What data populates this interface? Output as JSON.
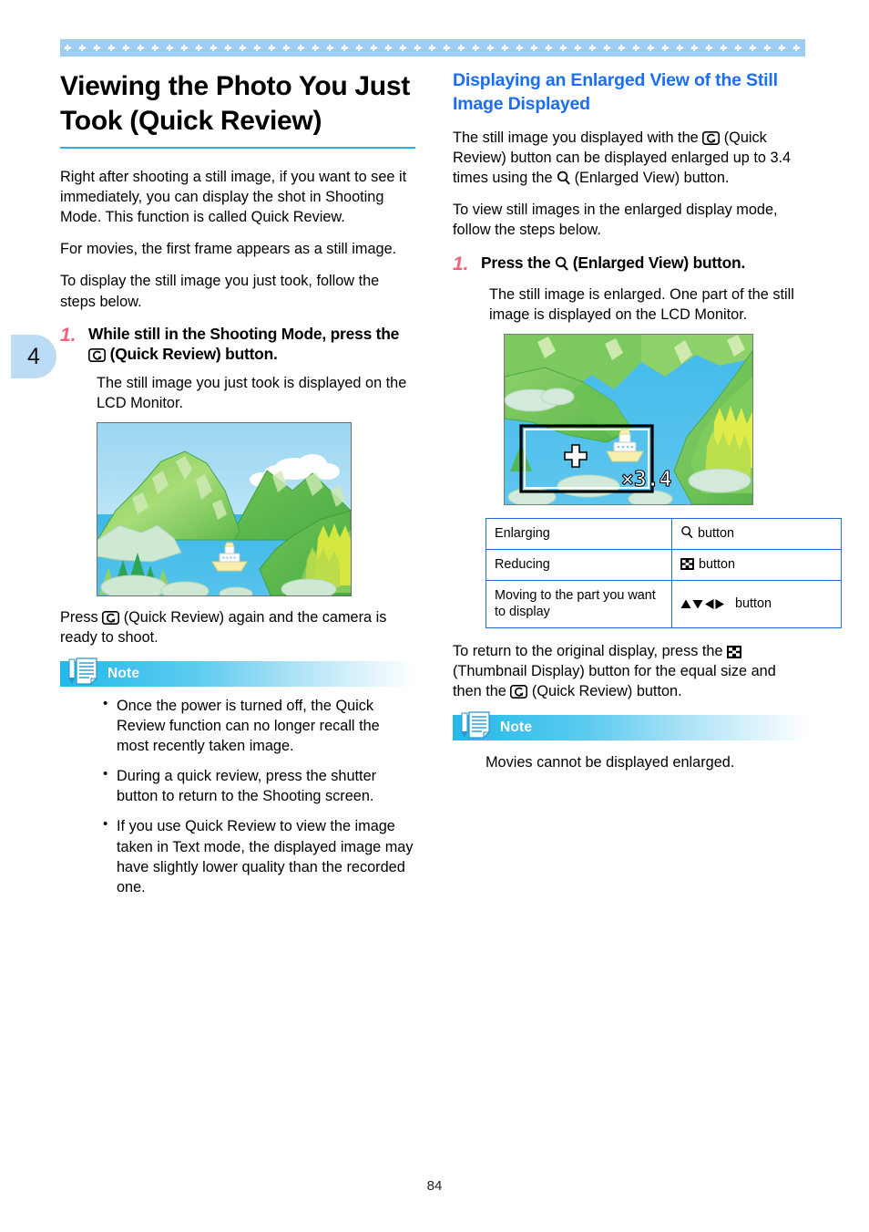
{
  "page": {
    "number": "84",
    "chapter_tab": "4"
  },
  "left": {
    "title": "Viewing the Photo You Just Took (Quick Review)",
    "para1": "Right after shooting a still image, if you want to see it immediately, you can display the shot in Shooting Mode. This function is called Quick Review.",
    "para2": "For movies, the first frame appears as a still image.",
    "para3": "To display the still image you just took, follow the steps below.",
    "step1_num": "1.",
    "step1_text_a": "While still in the Shooting Mode, press the",
    "step1_text_b": "(Quick Review) button.",
    "step1_body": "The still image you just took is displayed on the LCD Monitor.",
    "after_fig_a": "Press",
    "after_fig_b": "(Quick Review) again and the camera is ready to shoot.",
    "note": {
      "label": "Note",
      "items": [
        "Once the power is turned off, the Quick Review function can no longer recall the most recently taken image.",
        "During a quick review, press the shutter button to return to the Shooting screen.",
        "If you use Quick Review to view the image taken in Text mode, the displayed image may have slightly lower quality than the recorded one."
      ]
    }
  },
  "right": {
    "subhead": "Displaying an Enlarged View of the Still Image Displayed",
    "para1_a": "The still image you displayed with the",
    "para1_b": "(Quick Review) button can be displayed enlarged up to 3.4 times using the",
    "para1_c": "(Enlarged View) button.",
    "para2": "To view still images in the enlarged display mode, follow the steps below.",
    "step1_num": "1.",
    "step1_text_a": "Press the",
    "step1_text_b": "(Enlarged View) button.",
    "step1_body": "The still image is enlarged. One part of the still image is displayed on the LCD Monitor.",
    "figure_zoom_label": "×3.4",
    "table": {
      "rows": [
        {
          "action": "Enlarging",
          "button_suffix": "button",
          "icon": "magnifier-icon"
        },
        {
          "action": "Reducing",
          "button_suffix": "button",
          "icon": "thumbnail-icon"
        },
        {
          "action": "Moving to the part you want to display",
          "button_suffix": "button",
          "icon": "dpad-arrows-icon"
        }
      ]
    },
    "closing_a": "To return to the original display, press the",
    "closing_b": "(Thumbnail Display) button for the equal size and then the",
    "closing_c": "(Quick Review) button.",
    "note": {
      "label": "Note",
      "text": "Movies cannot be displayed enlarged."
    }
  },
  "colors": {
    "band": "#9dcdf0",
    "heading_blue": "#1a6ef5",
    "rule_cyan": "#29b4e8",
    "step_number_pink": "#f4607a",
    "note_cyan": "#23b9ea",
    "table_border_blue": "#1b6fd6",
    "tab_blue": "#bcdcf5"
  }
}
